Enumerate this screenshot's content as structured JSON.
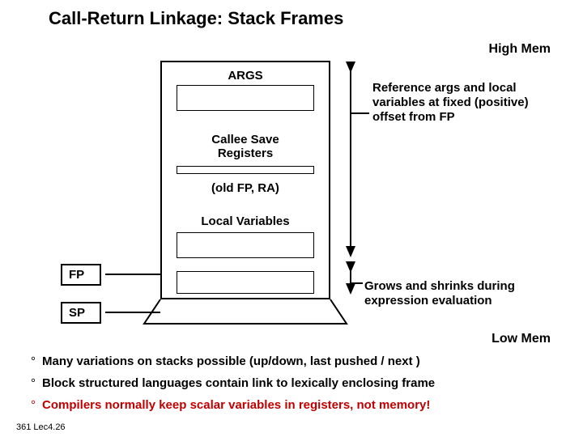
{
  "title": "Call-Return Linkage: Stack Frames",
  "labels": {
    "high_mem": "High Mem",
    "low_mem": "Low Mem",
    "args": "ARGS",
    "callee_save": "Callee Save\nRegisters",
    "old_fp": "(old FP,  RA)",
    "local_vars": "Local Variables",
    "fp": "FP",
    "sp": "SP"
  },
  "notes": {
    "reference": "Reference args and local variables at fixed (positive) offset from FP",
    "grows": "Grows and shrinks during expression evaluation"
  },
  "bullets": {
    "b1": "Many variations on stacks possible (up/down, last pushed / next )",
    "b2": "Block structured languages contain link to lexically enclosing frame",
    "b3": "Compilers normally keep scalar variables in registers, not memory!"
  },
  "footer": "361  Lec4.26",
  "degree": "°"
}
